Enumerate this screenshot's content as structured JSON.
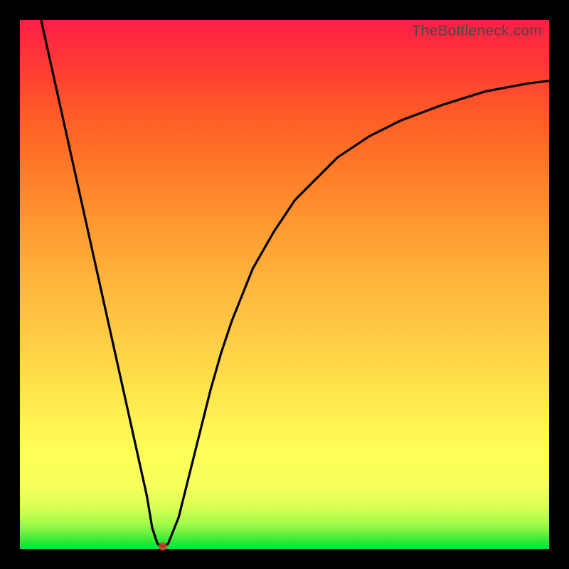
{
  "watermark": "TheBottleneck.com",
  "chart_data": {
    "type": "line",
    "title": "",
    "xlabel": "",
    "ylabel": "",
    "xlim": [
      0,
      100
    ],
    "ylim": [
      0,
      100
    ],
    "grid": false,
    "series": [
      {
        "name": "bottleneck-curve",
        "x": [
          4,
          6,
          8,
          10,
          12,
          14,
          16,
          18,
          20,
          22,
          24,
          25,
          26,
          27,
          28,
          30,
          32,
          34,
          36,
          38,
          40,
          44,
          48,
          52,
          56,
          60,
          66,
          72,
          80,
          88,
          96,
          100
        ],
        "y": [
          100,
          91,
          82,
          73,
          64,
          55,
          46,
          37,
          28,
          19,
          10,
          4,
          1,
          0.5,
          1,
          6,
          14,
          22,
          30,
          37,
          43,
          53,
          60,
          66,
          70,
          74,
          78,
          81,
          84,
          86.5,
          88,
          88.5
        ]
      }
    ],
    "marker": {
      "x": 27,
      "y": 0.5,
      "name": "minimum-point"
    },
    "colors": {
      "curve": "#000000",
      "gradient_top": "#ff1d46",
      "gradient_bottom": "#06e33c",
      "frame": "#000000"
    }
  }
}
